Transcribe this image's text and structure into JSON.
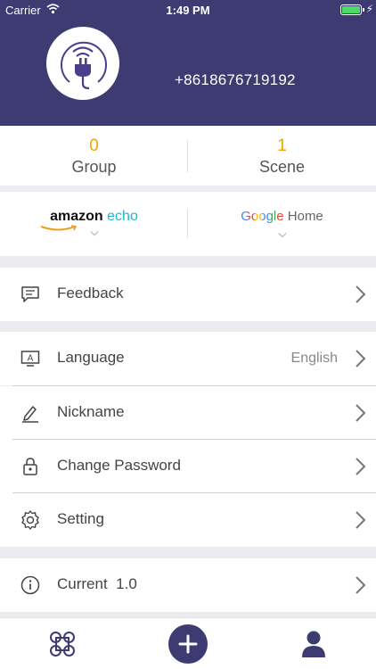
{
  "status_bar": {
    "carrier": "Carrier",
    "time": "1:49 PM"
  },
  "profile": {
    "phone": "+8618676719192",
    "avatar_icon": "plug-icon"
  },
  "stats": [
    {
      "count": "0",
      "label": "Group"
    },
    {
      "count": "1",
      "label": "Scene"
    }
  ],
  "partners": {
    "amazon": {
      "brand": "amazon",
      "product": "echo"
    },
    "google": {
      "brand": "Google",
      "product": "Home"
    }
  },
  "menu": {
    "feedback": {
      "label": "Feedback"
    },
    "language": {
      "label": "Language",
      "value": "English"
    },
    "nickname": {
      "label": "Nickname"
    },
    "change_password": {
      "label": "Change Password"
    },
    "setting": {
      "label": "Setting"
    },
    "current": {
      "label": "Current",
      "value": "1.0"
    }
  },
  "colors": {
    "primary": "#3d3b72",
    "accent": "#f0a500",
    "echo": "#1fb6d9"
  }
}
